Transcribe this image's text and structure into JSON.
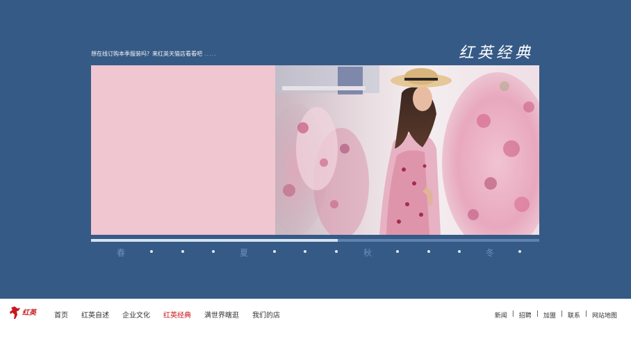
{
  "hero": {
    "promo_text": "想在线订购本季服装吗？来红英天猫店看看吧",
    "promo_dots": ".....",
    "brand_title": "红英经典",
    "background_color": "#365a86"
  },
  "banner": {
    "pink_color": "#f0c6d0",
    "photo": "woman-in-straw-hat-floral-dress-photo"
  },
  "carousel": {
    "progress": 0.55,
    "seasons": [
      "春",
      "夏",
      "秋",
      "冬"
    ]
  },
  "footer": {
    "logo_text": "红英",
    "logo_icon": "red-horse-logo-icon",
    "nav": [
      {
        "label": "首页",
        "active": false
      },
      {
        "label": "红英自述",
        "active": false
      },
      {
        "label": "企业文化",
        "active": false
      },
      {
        "label": "红英经典",
        "active": true
      },
      {
        "label": "满世界瞎逛",
        "active": false
      },
      {
        "label": "我们的店",
        "active": false
      }
    ],
    "links": [
      "新闻",
      "招聘",
      "加盟",
      "联系",
      "网站地图"
    ],
    "separator": "|",
    "accent_color": "#c8171d"
  }
}
